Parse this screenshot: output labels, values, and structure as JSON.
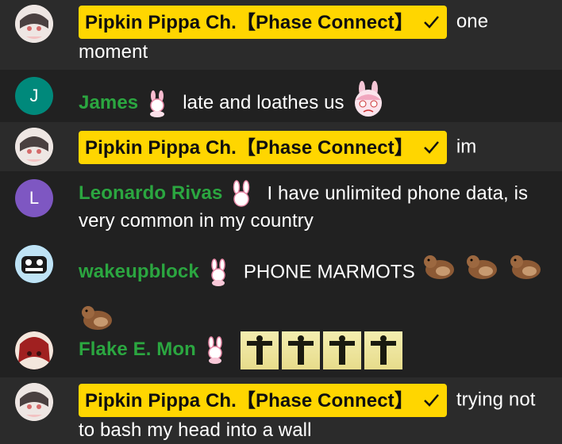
{
  "chat": {
    "messages": [
      {
        "author": "Pipkin Pippa Ch.【Phase Connect】",
        "is_owner": true,
        "text": "one moment"
      },
      {
        "author": "James",
        "avatar_letter": "J",
        "avatar_color": "#00897b",
        "text": "late and loathes us"
      },
      {
        "author": "Pipkin Pippa Ch.【Phase Connect】",
        "is_owner": true,
        "text": "im"
      },
      {
        "author": "Leonardo Rivas",
        "avatar_letter": "L",
        "avatar_color": "#7e57c2",
        "text": "I have unlimited phone data, is very common in my country"
      },
      {
        "author": "wakeupblock",
        "text": "PHONE MARMOTS"
      },
      {
        "author": "Flake E. Mon",
        "text": ""
      },
      {
        "author": "Pipkin Pippa Ch.【Phase Connect】",
        "is_owner": true,
        "text": "trying not to bash my head into a wall"
      }
    ]
  },
  "colors": {
    "background": "#212121",
    "owner_row": "#2b2b2b",
    "owner_badge": "#ffd600",
    "member_name": "#2ba640"
  },
  "icons": {
    "verified": "check-icon",
    "member_badge": "bunny-badge-icon",
    "marmot_emote": "marmot-emote-icon"
  }
}
